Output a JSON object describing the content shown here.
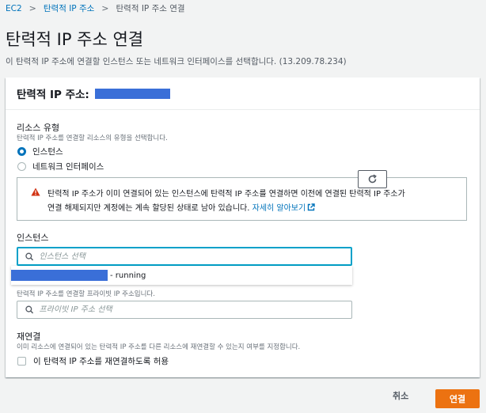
{
  "breadcrumb": {
    "items": [
      "EC2",
      "탄력적 IP 주소",
      "탄력적 IP 주소 연결"
    ]
  },
  "page": {
    "title": "탄력적 IP 주소 연결",
    "description": "이 탄력적 IP 주소에 연결할 인스턴스 또는 네트워크 인터페이스를 선택합니다. (13.209.78.234)"
  },
  "panel": {
    "title": "탄력적 IP 주소:"
  },
  "resource_type": {
    "label": "리소스 유형",
    "hint": "탄력적 IP 주소를 연결할 리소스의 유형을 선택합니다.",
    "options": [
      "인스턴스",
      "네트워크 인터페이스"
    ],
    "selected": "인스턴스"
  },
  "alert": {
    "line1": "탄력적 IP 주소가 이미 연결되어 있는 인스턴스에 탄력적 IP 주소를 연결하면 이전에 연결된 탄력적 IP 주소가",
    "line2": "연결 해제되지만 계정에는 계속 할당된 상태로 남아 있습니다.",
    "link": "자세히 알아보기"
  },
  "instance": {
    "label": "인스턴스",
    "placeholder": "인스턴스 선택",
    "dropdown_option_suffix": "- running"
  },
  "private_ip": {
    "hint": "탄력적 IP 주소를 연결할 프라이빗 IP 주소입니다.",
    "placeholder": "프라이빗 IP 주소 선택"
  },
  "reassociate": {
    "label": "재연결",
    "hint": "이미 리소스에 연결되어 있는 탄력적 IP 주소를 다른 리소스에 재연결할 수 있는지 여부를 지정합니다.",
    "checkbox_label": "이 탄력적 IP 주소를 재연결하도록 허용",
    "checked": false
  },
  "footer": {
    "cancel": "취소",
    "connect": "연결"
  },
  "colors": {
    "link": "#0073bb",
    "primary_button": "#ec7211",
    "focus": "#00a1c9",
    "warning": "#d13212"
  }
}
